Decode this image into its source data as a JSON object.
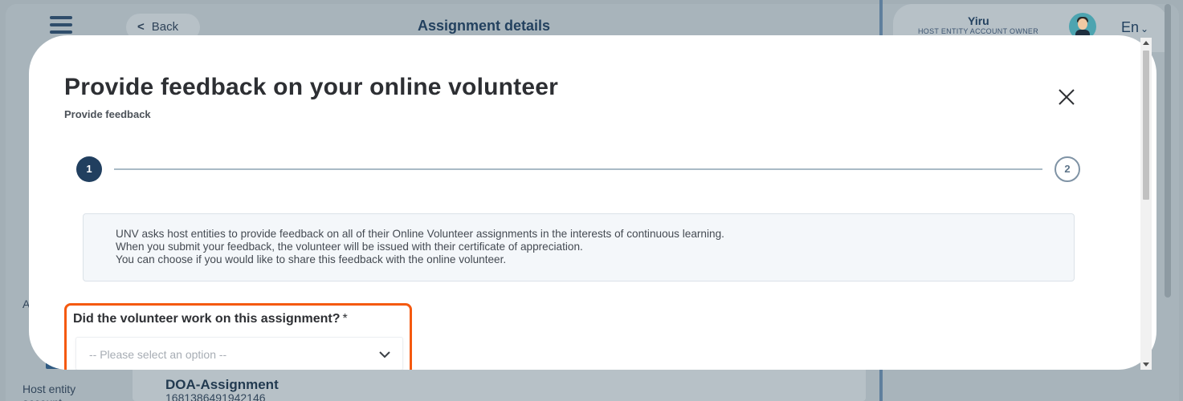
{
  "background": {
    "header_title": "Assignment details",
    "back_label": "Back",
    "back_chevron": "<",
    "user": {
      "name": "Yiru",
      "role": "HOST ENTITY ACCOUNT OWNER"
    },
    "language": "En",
    "sidebar": {
      "partial_letter": "A",
      "host_entity_label": "Host entity account"
    },
    "card": {
      "title": "DOA-Assignment",
      "id": "1681386491942146"
    }
  },
  "modal": {
    "title": "Provide feedback on your online volunteer",
    "subtitle": "Provide feedback",
    "steps": [
      {
        "label": "1",
        "state": "active"
      },
      {
        "label": "2",
        "state": "inactive"
      }
    ],
    "info_lines": [
      "UNV asks host entities to provide feedback on all of their Online Volunteer assignments in the interests of continuous learning.",
      "When you submit your feedback, the volunteer will be issued with their certificate of appreciation.",
      "You can choose if you would like to share this feedback with the online volunteer."
    ],
    "question": {
      "label": "Did the volunteer work on this assignment?",
      "required_marker": "*",
      "placeholder": "-- Please select an option --"
    }
  },
  "colors": {
    "primary_navy": "#213f5f",
    "highlight_orange": "#f5590f",
    "backdrop": "#a8b4bb"
  },
  "icons": [
    "hamburger-icon",
    "back-chevron-icon",
    "avatar",
    "language-chevron-icon",
    "close-icon",
    "select-chevron-icon",
    "host-entity-icon"
  ]
}
